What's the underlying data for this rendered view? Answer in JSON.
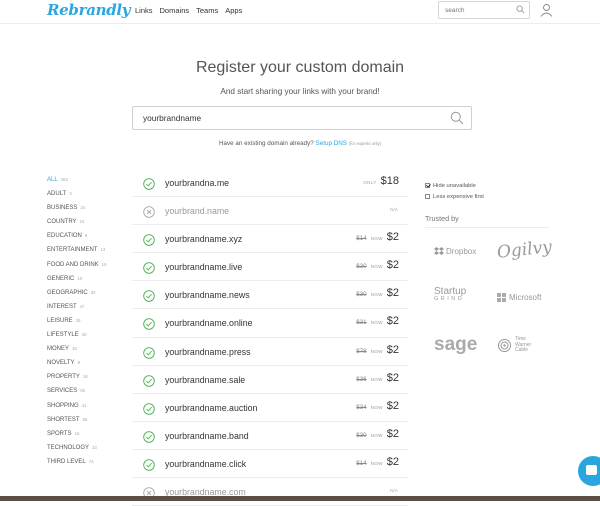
{
  "header": {
    "logo_text": "Rebrandly",
    "nav": [
      "Links",
      "Domains",
      "Teams",
      "Apps"
    ],
    "search_placeholder": "search"
  },
  "hero": {
    "title": "Register your custom domain",
    "subtitle": "And start sharing your links with your brand!",
    "search_value": "yourbrandname"
  },
  "dns": {
    "question": "Have an existing domain already?",
    "link": "Setup DNS",
    "note": "(for experts only)"
  },
  "categories": [
    {
      "name": "ALL",
      "count": "483",
      "active": true
    },
    {
      "name": "ADULT",
      "count": "3"
    },
    {
      "name": "BUSINESS",
      "count": "34"
    },
    {
      "name": "COUNTRY",
      "count": "24"
    },
    {
      "name": "EDUCATION",
      "count": "6"
    },
    {
      "name": "ENTERTAINMENT",
      "count": "13"
    },
    {
      "name": "FOOD AND DRINK",
      "count": "19"
    },
    {
      "name": "GENERIC",
      "count": "10"
    },
    {
      "name": "GEOGRAPHIC",
      "count": "32"
    },
    {
      "name": "INTEREST",
      "count": "47"
    },
    {
      "name": "LEISURE",
      "count": "28"
    },
    {
      "name": "LIFESTYLE",
      "count": "40"
    },
    {
      "name": "MONEY",
      "count": "18"
    },
    {
      "name": "NOVELTY",
      "count": "9"
    },
    {
      "name": "PROPERTY",
      "count": "18"
    },
    {
      "name": "SERVICES",
      "count": "65"
    },
    {
      "name": "SHOPPING",
      "count": "41"
    },
    {
      "name": "SHORTEST",
      "count": "58"
    },
    {
      "name": "SPORTS",
      "count": "16"
    },
    {
      "name": "TECHNOLOGY",
      "count": "23"
    },
    {
      "name": "THIRD LEVEL",
      "count": "74"
    }
  ],
  "domains": [
    {
      "name": "yourbrandna.me",
      "available": true,
      "label": "ONLY",
      "price": "$18"
    },
    {
      "name": "yourbrand.name",
      "available": false,
      "label": "N/A"
    },
    {
      "name": "yourbrandname.xyz",
      "available": true,
      "old": "$14",
      "label": "NOW",
      "price": "$2"
    },
    {
      "name": "yourbrandname.live",
      "available": true,
      "old": "$30",
      "label": "NOW",
      "price": "$2"
    },
    {
      "name": "yourbrandname.news",
      "available": true,
      "old": "$30",
      "label": "NOW",
      "price": "$2"
    },
    {
      "name": "yourbrandname.online",
      "available": true,
      "old": "$31",
      "label": "NOW",
      "price": "$2"
    },
    {
      "name": "yourbrandname.press",
      "available": true,
      "old": "$78",
      "label": "NOW",
      "price": "$2"
    },
    {
      "name": "yourbrandname.sale",
      "available": true,
      "old": "$36",
      "label": "NOW",
      "price": "$2"
    },
    {
      "name": "yourbrandname.auction",
      "available": true,
      "old": "$34",
      "label": "NOW",
      "price": "$2"
    },
    {
      "name": "yourbrandname.band",
      "available": true,
      "old": "$30",
      "label": "NOW",
      "price": "$2"
    },
    {
      "name": "yourbrandname.click",
      "available": true,
      "old": "$14",
      "label": "NOW",
      "price": "$2"
    },
    {
      "name": "yourbrandname.com",
      "available": false,
      "label": "N/A"
    }
  ],
  "options": [
    {
      "label": "Hide unavailable",
      "checked": true
    },
    {
      "label": "Less expensive first",
      "checked": false
    }
  ],
  "trusted": {
    "title": "Trusted by",
    "brands": {
      "dropbox": "Dropbox",
      "ogilvy": "Ogilvy",
      "startup_line1": "Startup",
      "startup_line2": "GRIND",
      "microsoft": "Microsoft",
      "sage": "sage",
      "twc_line1": "Time",
      "twc_line2": "Warner",
      "twc_line3": "Cable"
    }
  },
  "colors": {
    "accent": "#2aa6de",
    "check": "#4caf50",
    "unavailable": "#aaaaaa"
  }
}
